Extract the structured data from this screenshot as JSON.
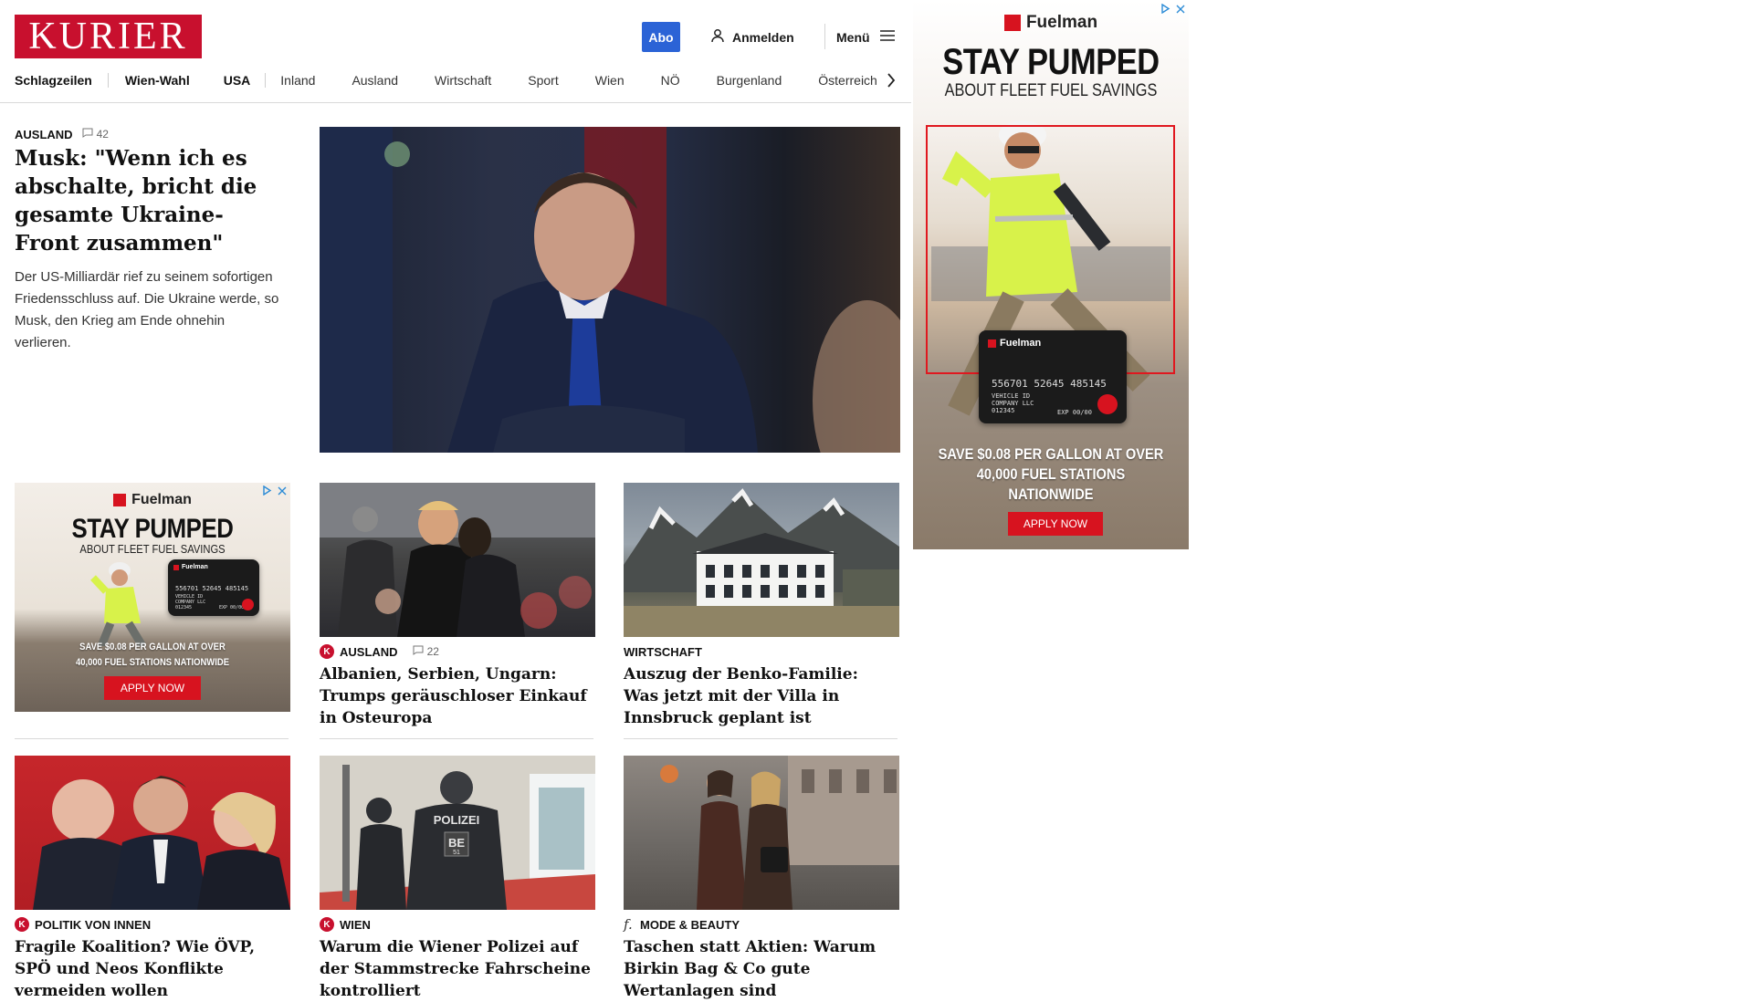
{
  "header": {
    "logo_text": "KURIER",
    "abo_label": "Abo",
    "login_label": "Anmelden",
    "menu_label": "Menü"
  },
  "nav": {
    "items": [
      "Schlagzeilen",
      "Wien-Wahl",
      "USA",
      "Inland",
      "Ausland",
      "Wirtschaft",
      "Sport",
      "Wien",
      "NÖ",
      "Burgenland",
      "Österreich"
    ]
  },
  "lead": {
    "rubric": "AUSLAND",
    "comments": "42",
    "title": "Musk: \"Wenn ich es abschalte, bricht die gesamte Ukraine-Front zusammen\"",
    "teaser": "Der US-Milliardär rief zu seinem sofortigen Friedensschluss auf. Die Ukraine werde, so Musk, den Krieg am Ende ohnehin verlieren."
  },
  "cards": [
    {
      "rubric": "AUSLAND",
      "comments": "22",
      "title": "Albanien, Serbien, Ungarn: Trumps geräuschloser Einkauf in Osteuropa"
    },
    {
      "rubric": "WIRTSCHAFT",
      "title": "Auszug der Benko-Familie: Was jetzt mit der Villa in Innsbruck geplant ist"
    },
    {
      "rubric": "POLITIK VON INNEN",
      "title": "Fragile Koalition? Wie ÖVP, SPÖ und Neos Konflikte vermeiden wollen"
    },
    {
      "rubric": "WIEN",
      "title": "Warum die Wiener Polizei auf der Stammstrecke Fahrscheine kontrolliert"
    },
    {
      "rubric": "MODE & BEAUTY",
      "title": "Taschen statt Aktien: Warum Birkin Bag & Co gute Wertanlagen sind"
    }
  ],
  "ads": {
    "brand": "Fuelman",
    "headline": "STAY PUMPED",
    "subline": "ABOUT FLEET FUEL SAVINGS",
    "offer": "SAVE $0.08 PER GALLON AT OVER 40,000 FUEL STATIONS NATIONWIDE",
    "cta": "APPLY NOW",
    "card_brand": "Fuelman",
    "card_number": "556701 52645 485145",
    "card_line1": "VEHICLE ID",
    "card_line2": "COMPANY LLC",
    "card_line3": "012345",
    "card_exp": "EXP 00/00",
    "police_vest": "POLIZEI",
    "police_vest_code": "BE",
    "police_vest_num": "51"
  },
  "colors": {
    "brand_red": "#c8102e",
    "abo_blue": "#2b63d6",
    "ad_red": "#d7131f"
  },
  "icons": [
    "user-icon",
    "hamburger-icon",
    "chevron-right-icon",
    "comment-icon",
    "k-brand-icon",
    "adchoices-icon",
    "close-icon"
  ]
}
